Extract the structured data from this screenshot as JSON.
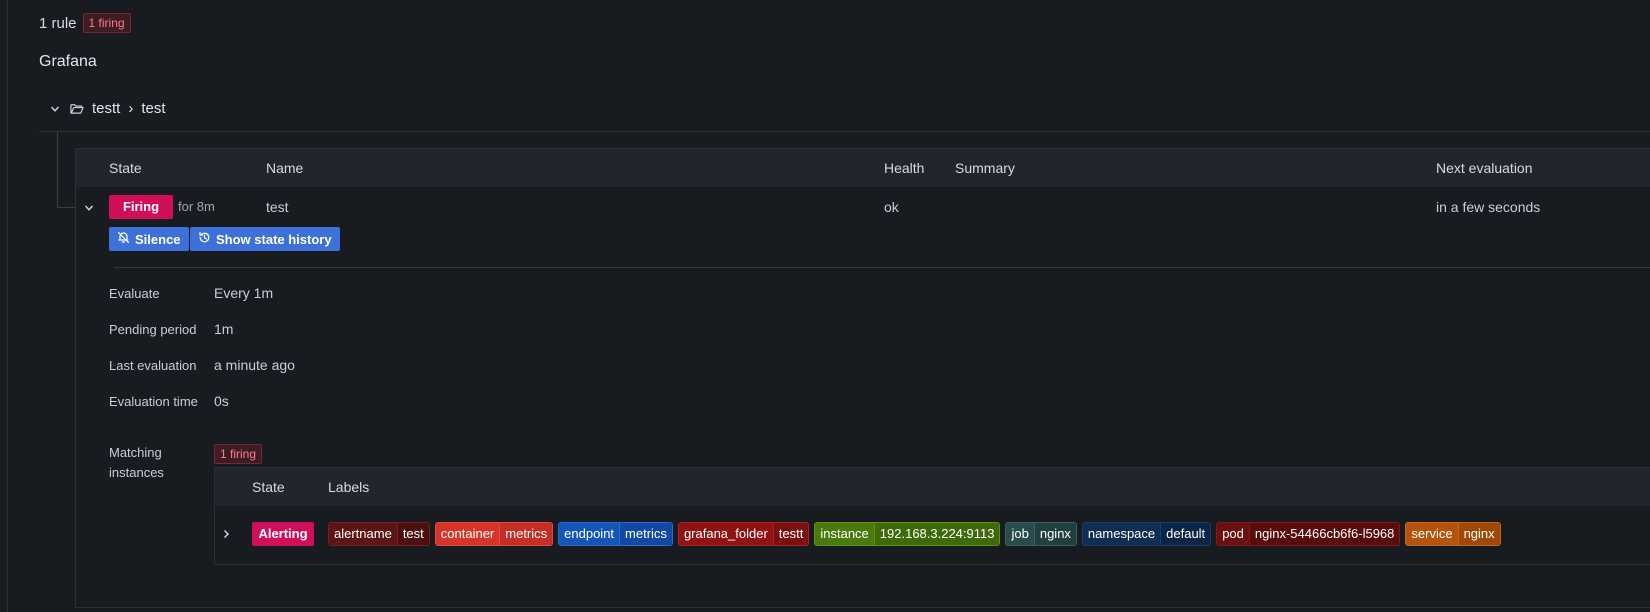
{
  "summary": {
    "rule_count": "1 rule",
    "firing_badge": "1 firing"
  },
  "namespace": {
    "title": "Grafana"
  },
  "group": {
    "folder": "testt",
    "separator": "›",
    "name": "test"
  },
  "table": {
    "headers": {
      "state": "State",
      "name": "Name",
      "health": "Health",
      "summary": "Summary",
      "next_eval": "Next evaluation"
    },
    "row": {
      "state": "Firing",
      "for": "for 8m",
      "name": "test",
      "health": "ok",
      "summary": "",
      "next_eval": "in a few seconds"
    }
  },
  "actions": {
    "silence": "Silence",
    "history": "Show state history"
  },
  "details": {
    "evaluate_label": "Evaluate",
    "evaluate_value": "Every 1m",
    "pending_label": "Pending period",
    "pending_value": "1m",
    "last_eval_label": "Last evaluation",
    "last_eval_value": "a minute ago",
    "eval_time_label": "Evaluation time",
    "eval_time_value": "0s",
    "matching_label_1": "Matching",
    "matching_label_2": "instances",
    "matching_badge": "1 firing"
  },
  "instances": {
    "headers": {
      "state": "State",
      "labels": "Labels"
    },
    "row": {
      "state": "Alerting",
      "labels": [
        {
          "key": "alertname",
          "value": "test",
          "kbg": "#5c1414",
          "vbg": "#4a1010",
          "border": "#7a1e1e"
        },
        {
          "key": "container",
          "value": "metrics",
          "kbg": "#d8352a",
          "vbg": "#c42e24",
          "border": "#e04a3f"
        },
        {
          "key": "endpoint",
          "value": "metrics",
          "kbg": "#1555b8",
          "vbg": "#124aa3",
          "border": "#2a6ad1"
        },
        {
          "key": "grafana_folder",
          "value": "testt",
          "kbg": "#8f1313",
          "vbg": "#7a0f0f",
          "border": "#a82222"
        },
        {
          "key": "instance",
          "value": "192.168.3.224:9113",
          "kbg": "#4a7a0c",
          "vbg": "#3e6a08",
          "border": "#5e9416"
        },
        {
          "key": "job",
          "value": "nginx",
          "kbg": "#2a4b4b",
          "vbg": "#223f3f",
          "border": "#3a6060"
        },
        {
          "key": "namespace",
          "value": "default",
          "kbg": "#0f2e54",
          "vbg": "#0b2546",
          "border": "#1a3d6a"
        },
        {
          "key": "pod",
          "value": "nginx-54466cb6f6-l5968",
          "kbg": "#6a1010",
          "vbg": "#580c0c",
          "border": "#831a1a"
        },
        {
          "key": "service",
          "value": "nginx",
          "kbg": "#b5520c",
          "vbg": "#a04808",
          "border": "#c9641a"
        }
      ]
    }
  },
  "icons": {
    "folder": "folder-open-icon",
    "chevron": "chevron-down-icon",
    "silence": "bell-slash-icon",
    "history": "history-icon"
  }
}
